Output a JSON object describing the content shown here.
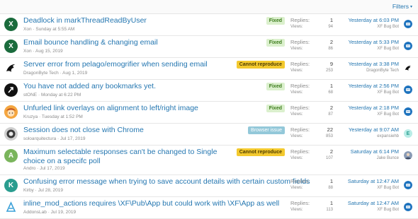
{
  "filters_label": "Filters",
  "threads": [
    {
      "title": "Deadlock in markThreadReadByUser",
      "author": "Xon",
      "date": "Sunday at 5:55 AM",
      "prefix": "Fixed",
      "replies_label": "Replies:",
      "replies": "1",
      "views_label": "Views:",
      "views": "94",
      "last_date": "Yesterday at 6:03 PM",
      "last_user": "XF Bug Bot",
      "avatar_letter": "X"
    },
    {
      "title": "Email bounce handling & changing email",
      "author": "Xon",
      "date": "Aug 15, 2019",
      "prefix": "Fixed",
      "replies_label": "Replies:",
      "replies": "2",
      "views_label": "Views:",
      "views": "86",
      "last_date": "Yesterday at 5:33 PM",
      "last_user": "XF Bug Bot",
      "avatar_letter": "X"
    },
    {
      "title": "Server error from pelago/emogrifier when sending email",
      "author": "DragonByte Tech",
      "date": "Aug 1, 2019",
      "prefix": "Cannot reproduce",
      "replies_label": "Replies:",
      "replies": "9",
      "views_label": "Views:",
      "views": "253",
      "last_date": "Yesterday at 3:38 PM",
      "last_user": "DragonByte Tech",
      "avatar_letter": ""
    },
    {
      "title": "You have not added any bookmarks yet.",
      "author": "stONE",
      "date": "Monday at 6:22 PM",
      "prefix": "Fixed",
      "replies_label": "Replies:",
      "replies": "1",
      "views_label": "Views:",
      "views": "68",
      "last_date": "Yesterday at 2:56 PM",
      "last_user": "XF Bug Bot",
      "avatar_letter": ""
    },
    {
      "title": "Unfurled link overlays on alignment to left/right image",
      "author": "Kruzya",
      "date": "Tuesday at 1:52 PM",
      "prefix": "Fixed",
      "replies_label": "Replies:",
      "replies": "2",
      "views_label": "Views:",
      "views": "87",
      "last_date": "Yesterday at 2:18 PM",
      "last_user": "XF Bug Bot",
      "avatar_letter": ""
    },
    {
      "title": "Session does not close with Chrome",
      "author": "soloarquitectura",
      "date": "Jul 17, 2019",
      "prefix": "Browser issue",
      "replies_label": "Replies:",
      "replies": "22",
      "views_label": "Views:",
      "views": "853",
      "last_date": "Yesterday at 9:07 AM",
      "last_user": "expansiehb",
      "avatar_letter": "",
      "last_avatar_letter": "E"
    },
    {
      "title": "Maximum selectable responses can't be changed to Single choice on a specifc poll",
      "author": "Andro",
      "date": "Jul 17, 2019",
      "prefix": "Cannot reproduce",
      "replies_label": "Replies:",
      "replies": "2",
      "views_label": "Views:",
      "views": "107",
      "last_date": "Saturday at 6:14 PM",
      "last_user": "Jake Bunce",
      "avatar_letter": "A"
    },
    {
      "title": "Confusing error message when trying to save account details with certain custom fields",
      "author": "Kirby",
      "date": "Jul 28, 2019",
      "prefix": "",
      "replies_label": "Replies:",
      "replies": "1",
      "views_label": "Views:",
      "views": "88",
      "last_date": "Saturday at 12:47 AM",
      "last_user": "XF Bug Bot",
      "avatar_letter": "K"
    },
    {
      "title": "inline_mod_actions requires \\XF\\Pub\\App but could work with \\XF\\App as well",
      "author": "AddonsLab",
      "date": "Jul 19, 2019",
      "prefix": "",
      "replies_label": "Replies:",
      "replies": "1",
      "views_label": "Views:",
      "views": "113",
      "last_date": "Saturday at 12:47 AM",
      "last_user": "XF Bug Bot",
      "avatar_letter": ""
    }
  ],
  "colors": {
    "link": "#2577b1",
    "fixed_bg": "#dbf0cd",
    "fixed_fg": "#3b7b1b",
    "cannot_bg": "#f3c92e",
    "browser_bg": "#93c8d9",
    "avatar_x": "#1a6b3c",
    "avatar_a": "#7ab55c",
    "avatar_k": "#2a9d8f",
    "bot_avatar": "#1e73be"
  }
}
